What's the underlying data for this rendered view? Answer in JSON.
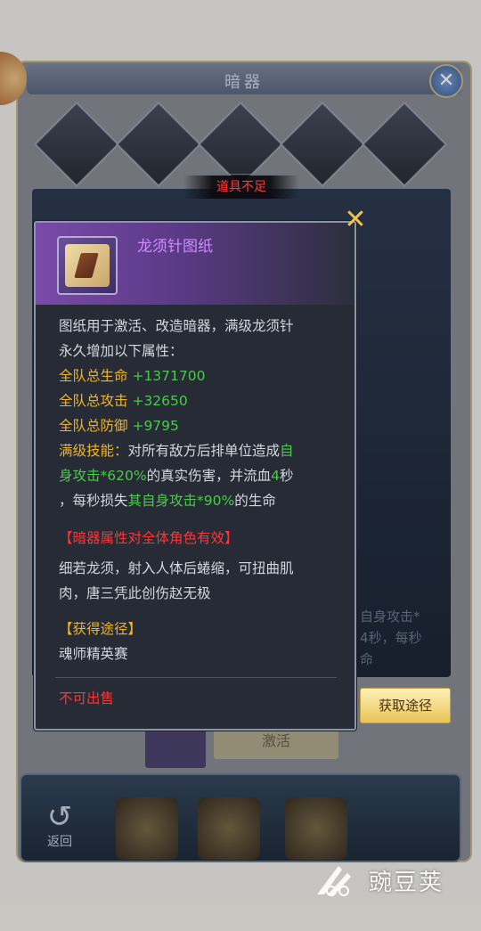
{
  "background": {
    "window_title": "暗器",
    "slot_labels": [
      "",
      "",
      "",
      "",
      ""
    ],
    "right_text_lines": [
      "自身攻击*",
      "4秒，每秒",
      "命"
    ],
    "activate_label": "激活",
    "back_label": "返回"
  },
  "toast": {
    "text": "道具不足"
  },
  "item": {
    "name": "龙须针图纸",
    "desc_lines": [
      "图纸用于激活、改造暗器，满级龙须针",
      "永久增加以下属性："
    ],
    "stats": [
      {
        "label": "全队总生命",
        "value": "+1371700"
      },
      {
        "label": "全队总攻击",
        "value": "+32650"
      },
      {
        "label": "全队总防御",
        "value": "+9795"
      }
    ],
    "skill": {
      "label": "满级技能：",
      "line1_a": "对所有敌方后排单位造成",
      "line1_b": "自",
      "line2_a": "身攻击*620%",
      "line2_b": "的真实伤害，并流血",
      "line2_c": "4",
      "line2_d": "秒",
      "line3_a": "，每秒损失",
      "line3_b": "其自身攻击*90%",
      "line3_c": "的生命"
    },
    "effect_note": "【暗器属性对全体角色有效】",
    "lore_lines": [
      "细若龙须，射入人体后蜷缩，可扭曲肌",
      "肉，唐三凭此创伤赵无极"
    ],
    "source_heading": "【获得途径】",
    "source": "魂师精英赛",
    "sell_status": "不可出售"
  },
  "get_path_button": "获取途径",
  "close_icon": "close-x",
  "watermark": "豌豆荚",
  "colors": {
    "gold": "#f0b429",
    "green": "#4cc94c",
    "red": "#ff3434",
    "purple_name": "#cf8cff"
  }
}
